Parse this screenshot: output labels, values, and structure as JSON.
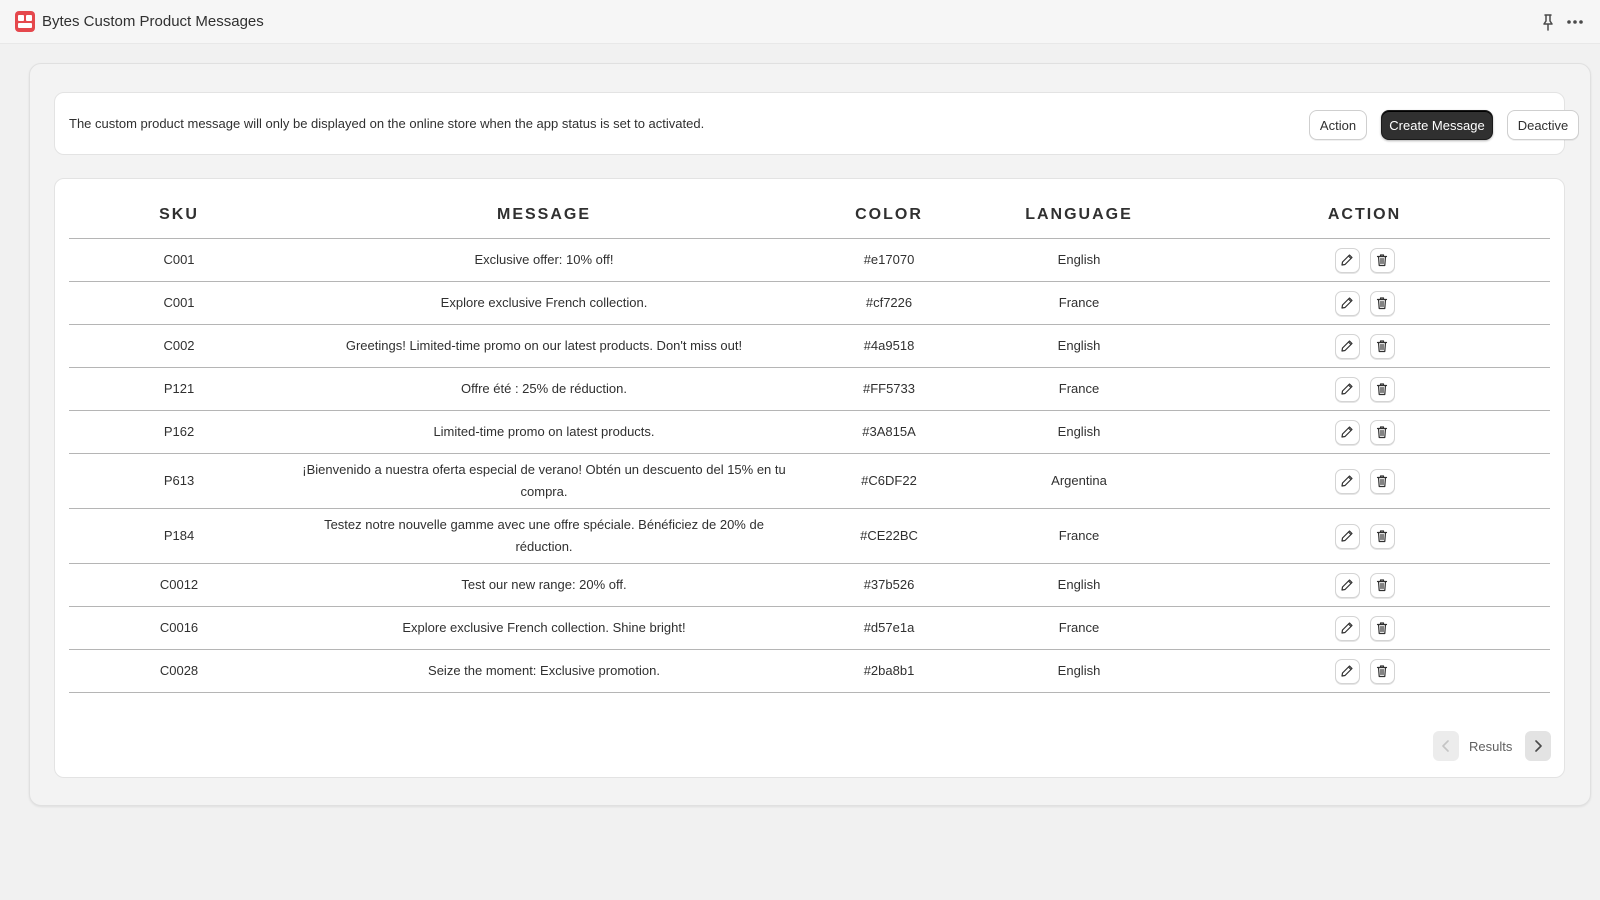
{
  "app": {
    "title": "Bytes Custom Product Messages"
  },
  "banner": {
    "text": "The custom product message will only be displayed on the online store when the app status is set to activated.",
    "action_label": "Action",
    "create_label": "Create Message",
    "deactive_label": "Deactive"
  },
  "table": {
    "headers": [
      "SKU",
      "MESSAGE",
      "COLOR",
      "LANGUAGE",
      "ACTION"
    ],
    "rows": [
      {
        "sku": "C001",
        "message": "Exclusive offer: 10% off!",
        "color": "#e17070",
        "language": "English"
      },
      {
        "sku": "C001",
        "message": "Explore exclusive French collection.",
        "color": "#cf7226",
        "language": "France"
      },
      {
        "sku": "C002",
        "message": "Greetings! Limited-time promo on our latest products. Don't miss out!",
        "color": "#4a9518",
        "language": "English"
      },
      {
        "sku": "P121",
        "message": "Offre été : 25% de réduction.",
        "color": "#FF5733",
        "language": "France"
      },
      {
        "sku": "P162",
        "message": "Limited-time promo on latest products.",
        "color": "#3A815A",
        "language": "English"
      },
      {
        "sku": "P613",
        "message": "¡Bienvenido a nuestra oferta especial de verano! Obtén un descuento del 15% en tu compra.",
        "color": "#C6DF22",
        "language": "Argentina"
      },
      {
        "sku": "P184",
        "message": "Testez notre nouvelle gamme avec une offre spéciale. Bénéficiez de 20% de réduction.",
        "color": "#CE22BC",
        "language": "France"
      },
      {
        "sku": "C0012",
        "message": "Test our new range: 20% off.",
        "color": "#37b526",
        "language": "English"
      },
      {
        "sku": "C0016",
        "message": "Explore exclusive French collection. Shine bright!",
        "color": "#d57e1a",
        "language": "France"
      },
      {
        "sku": "C0028",
        "message": "Seize the moment: Exclusive promotion.",
        "color": "#2ba8b1",
        "language": "English"
      }
    ]
  },
  "pagination": {
    "label": "Results"
  },
  "icons": {
    "logo": "app-logo-icon",
    "pin": "pin-icon",
    "more": "more-horizontal-icon",
    "edit": "pencil-icon",
    "delete": "trash-icon",
    "prev": "chevron-left-icon",
    "next": "chevron-right-icon"
  }
}
